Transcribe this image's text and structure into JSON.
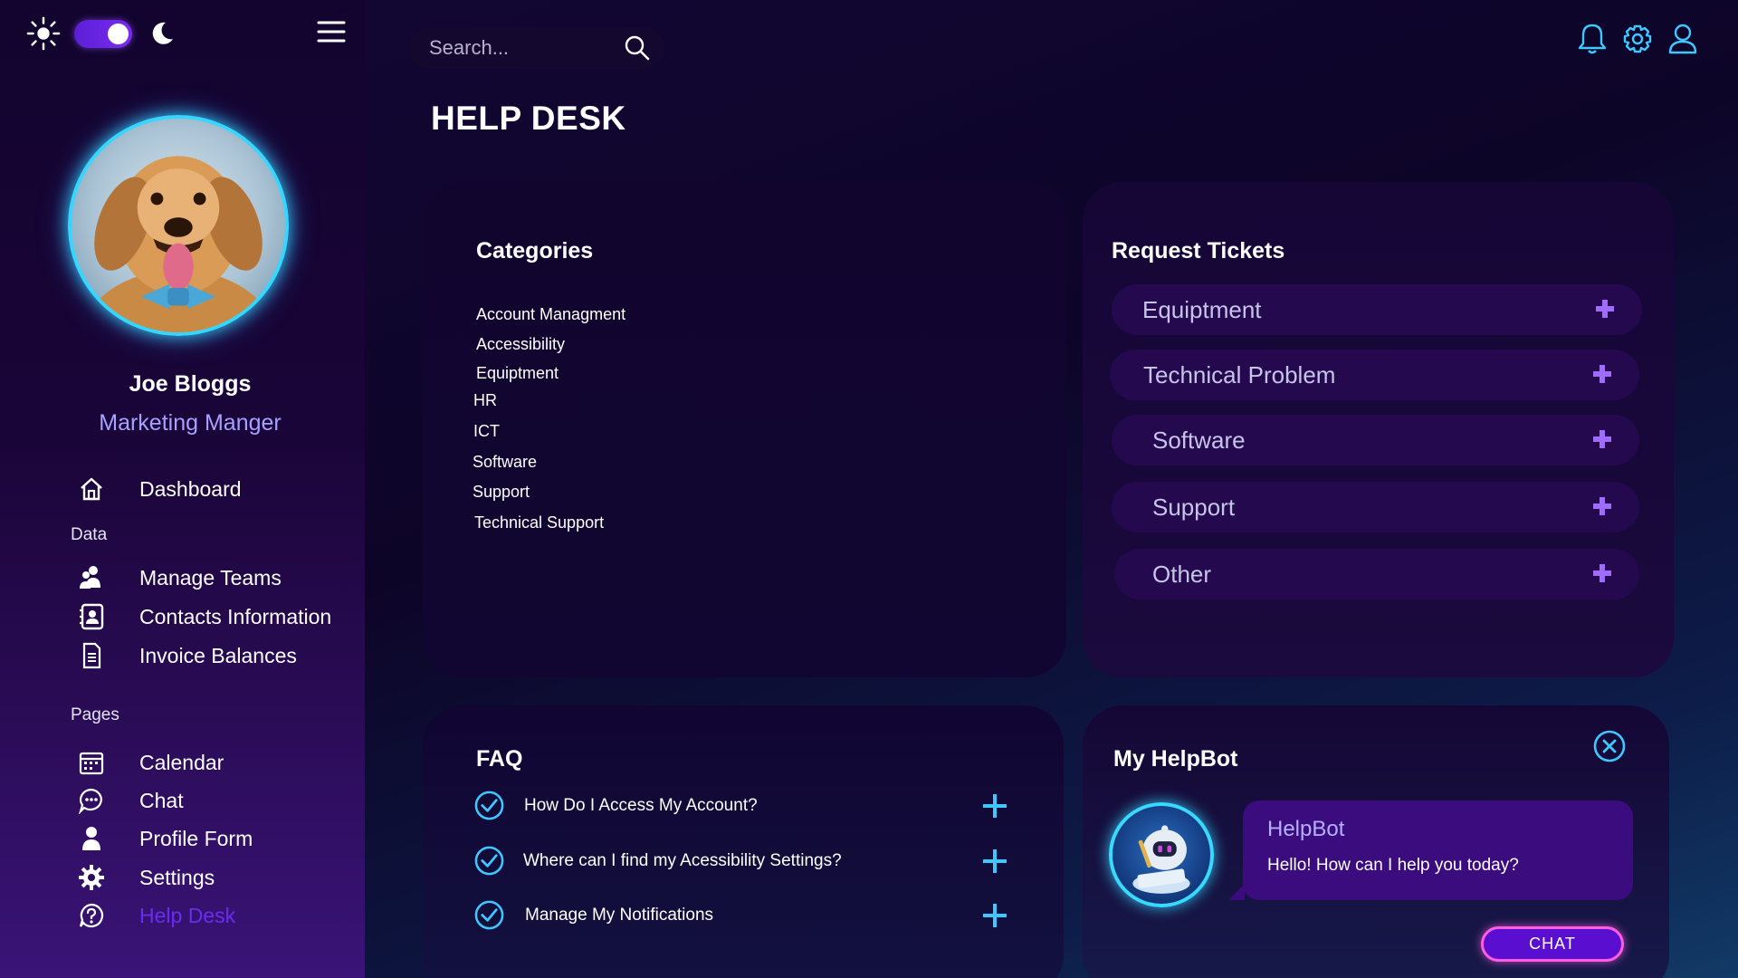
{
  "sidebar": {
    "user": {
      "name": "Joe Bloggs",
      "role": "Marketing Manger"
    },
    "nav_primary": [
      {
        "label": "Dashboard",
        "icon": "home-icon"
      }
    ],
    "sections": [
      {
        "label": "Data",
        "items": [
          {
            "label": "Manage Teams",
            "icon": "team-icon"
          },
          {
            "label": "Contacts Information",
            "icon": "contacts-icon"
          },
          {
            "label": "Invoice Balances",
            "icon": "invoice-icon"
          }
        ]
      },
      {
        "label": "Pages",
        "items": [
          {
            "label": "Calendar",
            "icon": "calendar-icon"
          },
          {
            "label": "Chat",
            "icon": "chat-icon"
          },
          {
            "label": "Profile Form",
            "icon": "person-icon"
          },
          {
            "label": "Settings",
            "icon": "gear-icon"
          },
          {
            "label": "Help Desk",
            "icon": "help-icon",
            "active": true
          }
        ]
      }
    ]
  },
  "header": {
    "search_placeholder": "Search...",
    "page_title": "HELP DESK"
  },
  "categories": {
    "title": "Categories",
    "items": [
      "Account Managment",
      "Accessibility",
      "Equiptment",
      "HR",
      "ICT",
      "Software",
      "Support",
      "Technical Support"
    ]
  },
  "tickets": {
    "title": "Request Tickets",
    "items": [
      "Equiptment",
      "Technical Problem",
      "Software",
      "Support",
      "Other"
    ]
  },
  "faq": {
    "title": "FAQ",
    "items": [
      "How Do I Access My Account?",
      "Where can I find my Acessibility Settings?",
      "Manage My Notifications"
    ]
  },
  "helpbot": {
    "title": "My HelpBot",
    "bot_name": "HelpBot",
    "message": "Hello! How can I help you today?",
    "button_label": "CHAT"
  },
  "colors": {
    "accent_purple": "#6a2cf0",
    "accent_cyan": "#38d8ff",
    "ticket_plus": "#a06cff",
    "chat_border": "#ff5ce4"
  }
}
